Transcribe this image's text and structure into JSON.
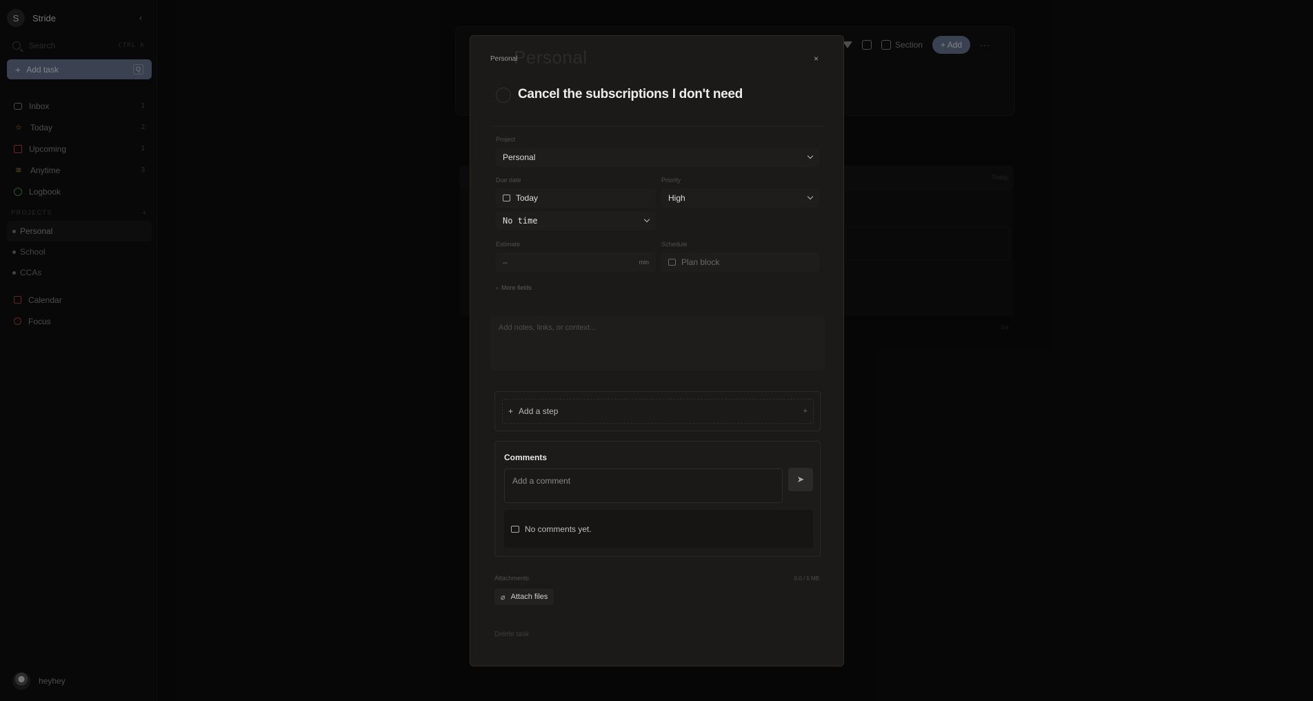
{
  "sidebar": {
    "workspace_initial": "S",
    "workspace_name": "Stride",
    "collapse_icon": "chevron-left-icon",
    "search_placeholder": "Search",
    "search_shortcut": "CTRL K",
    "add_task_label": "Add task",
    "add_task_shortcut": "Q",
    "nav": [
      {
        "label": "Inbox",
        "count": "1",
        "icon": "inbox-icon"
      },
      {
        "label": "Today",
        "count": "2",
        "icon": "star-icon"
      },
      {
        "label": "Upcoming",
        "count": "1",
        "icon": "calendar-icon"
      },
      {
        "label": "Anytime",
        "count": "3",
        "icon": "layers-icon"
      },
      {
        "label": "Logbook",
        "count": "",
        "icon": "check-circle-icon"
      }
    ],
    "projects_header": "PROJECTS",
    "projects_add": "+",
    "projects": [
      {
        "label": "Personal",
        "active": true
      },
      {
        "label": "School",
        "active": false
      },
      {
        "label": "CCAs",
        "active": false
      }
    ],
    "nav2": [
      {
        "label": "Calendar",
        "icon": "calendar-icon"
      },
      {
        "label": "Focus",
        "icon": "focus-icon"
      }
    ],
    "user_name": "heyhey"
  },
  "background": {
    "toolbar": {
      "section_label": "Section",
      "add_label": "Add",
      "more_label": "···"
    },
    "row_date": "Today",
    "row2_date": "Fri"
  },
  "modal": {
    "breadcrumb": "Personal",
    "ghost_title": "Personal",
    "close_label": "×",
    "title": "Cancel the subscriptions I don't need",
    "project": {
      "label": "Project",
      "value": "Personal"
    },
    "due_date": {
      "label": "Due date",
      "value": "Today"
    },
    "time": {
      "value": "No time"
    },
    "priority": {
      "label": "Priority",
      "value": "High"
    },
    "estimate": {
      "label": "Estimate",
      "value": "–",
      "unit": "min"
    },
    "schedule": {
      "label": "Schedule",
      "value": "Plan block"
    },
    "more_fields": "More fields",
    "notes_placeholder": "Add notes, links, or context...",
    "steps": {
      "add_label": "Add a step",
      "add_icon": "+"
    },
    "comments": {
      "title": "Comments",
      "placeholder": "Add a comment",
      "empty_text": "No comments yet."
    },
    "attachments": {
      "label": "Attachments",
      "size": "0.0 / 5 MB",
      "button_label": "Attach files"
    },
    "delete_label": "Delete task"
  }
}
